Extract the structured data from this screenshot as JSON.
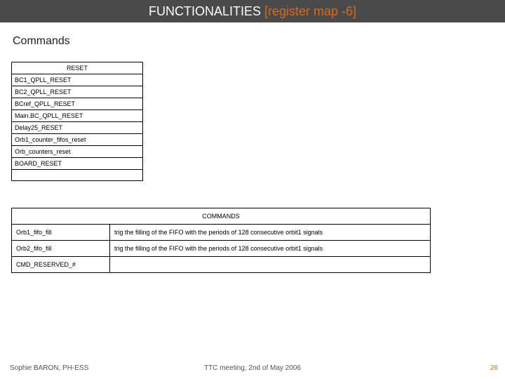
{
  "title": {
    "left": "FUNCTIONALITIES ",
    "right": "[register map -6]"
  },
  "section_heading": "Commands",
  "reset_table": {
    "header": "RESET",
    "rows": [
      "BC1_QPLL_RESET",
      "BC2_QPLL_RESET",
      "BCref_QPLL_RESET",
      "Main.BC_QPLL_RESET",
      "Delay25_RESET",
      "Orb1_counter_fifos_reset",
      "Orb_counters_reset",
      "BOARD_RESET"
    ],
    "blank": " "
  },
  "commands_table": {
    "header": "COMMANDS",
    "rows": [
      {
        "name": "Orb1_fifo_fill",
        "desc": "trig the filling of the FIFO with the periods of 128 consecutive orbit1 signals"
      },
      {
        "name": "Orb2_fifo_fill",
        "desc": "trig the filling of the FIFO with the periods of 128 consecutive orbit1 signals"
      },
      {
        "name": "CMD_RESERVED_#",
        "desc": ""
      }
    ]
  },
  "footer": {
    "author": "Sophie BARON, PH-ESS",
    "meeting": "TTC meeting, 2nd of May 2006",
    "page": "26"
  }
}
